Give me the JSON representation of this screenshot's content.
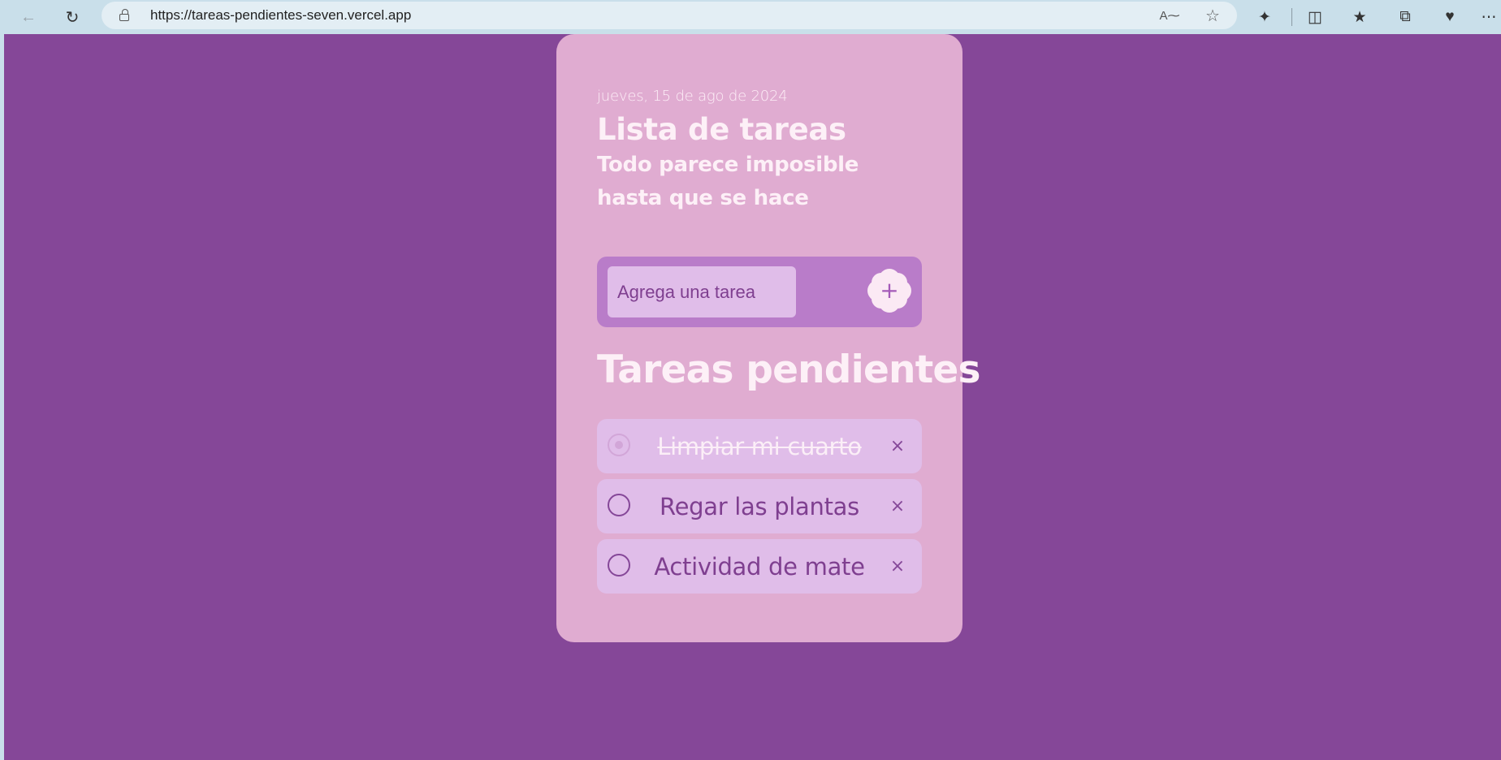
{
  "browser": {
    "url": "https://tareas-pendientes-seven.vercel.app",
    "icons": [
      "back-arrow-icon",
      "reload-icon",
      "lock-icon",
      "read-aloud-icon",
      "favorite-star-icon",
      "extensions-icon",
      "split-screen-icon",
      "favorites-icon",
      "collections-icon",
      "browser-essentials-icon",
      "more-icon"
    ]
  },
  "app": {
    "date": "jueves, 15 de ago de 2024",
    "title": "Lista de tareas",
    "subtitle": "Todo parece imposible hasta que se hace",
    "input_placeholder": "Agrega una tarea",
    "add_label": "+",
    "section_title": "Tareas pendientes",
    "tasks": [
      {
        "label": "Limpiar mi cuarto",
        "completed": true
      },
      {
        "label": "Regar las plantas",
        "completed": false
      },
      {
        "label": "Actividad de mate",
        "completed": false
      }
    ],
    "delete_label": "×"
  },
  "colors": {
    "page_bg": "#854798",
    "card_bg": "#e0acd1",
    "task_bg": "#e0bde9",
    "accent": "#b97cc9",
    "text_light": "#fdf0f7",
    "text_dark": "#7f3f90"
  }
}
